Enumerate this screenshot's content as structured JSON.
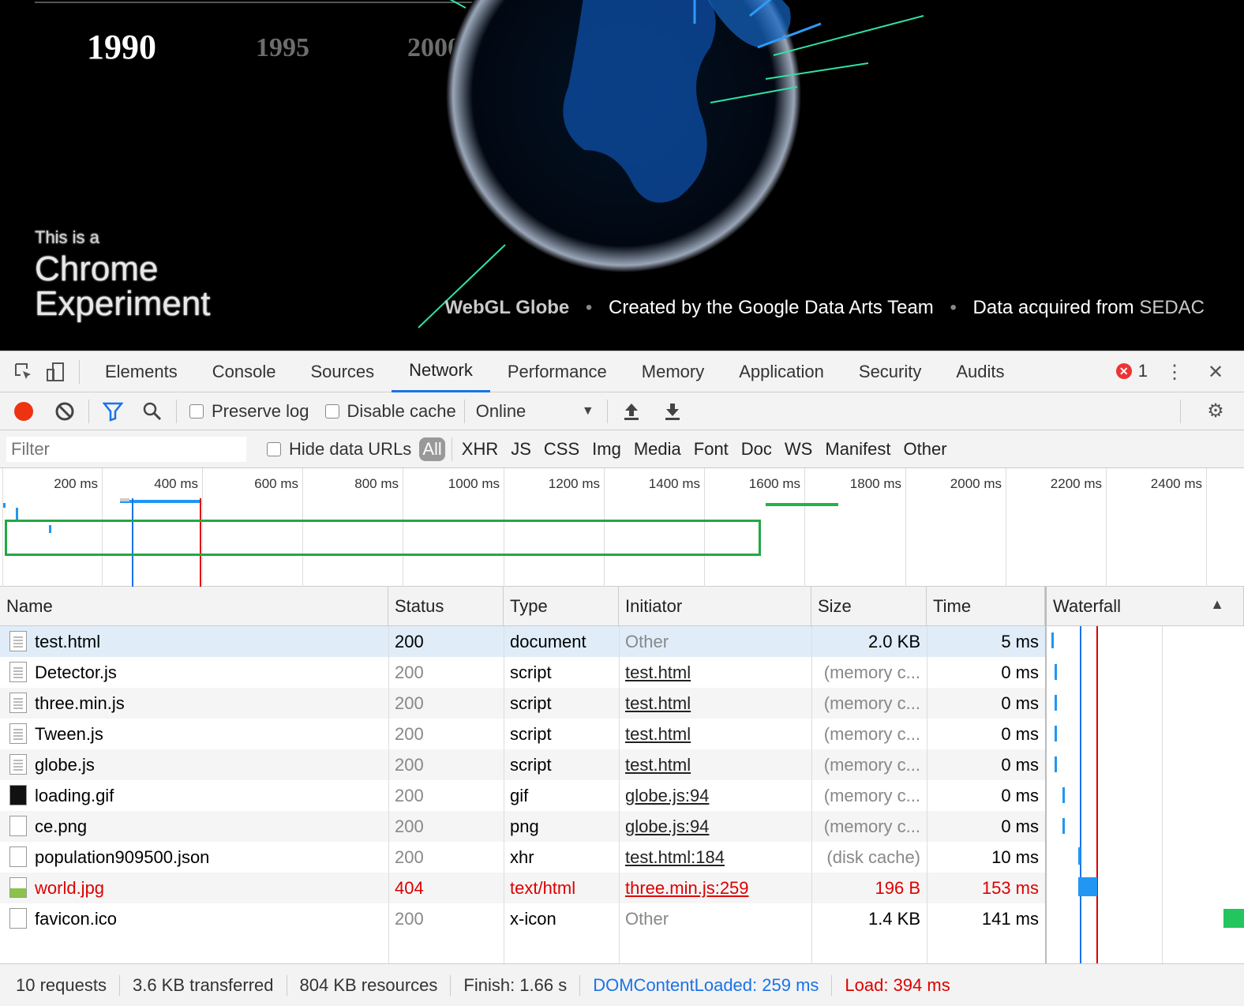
{
  "webpage": {
    "years": [
      "1990",
      "1995",
      "2000"
    ],
    "experiment_small": "This is a",
    "experiment_line1": "Chrome",
    "experiment_line2": "Experiment",
    "credits": {
      "app": "WebGL Globe",
      "team": "Created by the Google Data Arts Team",
      "data_prefix": "Data acquired from",
      "data_source": "SEDAC"
    }
  },
  "devtools": {
    "tabs": [
      "Elements",
      "Console",
      "Sources",
      "Network",
      "Performance",
      "Memory",
      "Application",
      "Security",
      "Audits"
    ],
    "active_tab": "Network",
    "error_count": "1",
    "toolbar": {
      "preserve_log": "Preserve log",
      "disable_cache": "Disable cache",
      "throttle": "Online"
    },
    "filter": {
      "placeholder": "Filter",
      "hide_data_urls": "Hide data URLs",
      "types": [
        "All",
        "XHR",
        "JS",
        "CSS",
        "Img",
        "Media",
        "Font",
        "Doc",
        "WS",
        "Manifest",
        "Other"
      ]
    },
    "overview_ticks": [
      "200 ms",
      "400 ms",
      "600 ms",
      "800 ms",
      "1000 ms",
      "1200 ms",
      "1400 ms",
      "1600 ms",
      "1800 ms",
      "2000 ms",
      "2200 ms",
      "2400 ms"
    ],
    "columns": [
      "Name",
      "Status",
      "Type",
      "Initiator",
      "Size",
      "Time",
      "Waterfall"
    ],
    "rows": [
      {
        "name": "test.html",
        "status": "200",
        "type": "document",
        "initiator": "Other",
        "size": "2.0 KB",
        "time": "5 ms",
        "icon": "doc-icon"
      },
      {
        "name": "Detector.js",
        "status": "200",
        "type": "script",
        "initiator": "test.html",
        "size": "(memory c...",
        "time": "0 ms",
        "icon": "doc-icon"
      },
      {
        "name": "three.min.js",
        "status": "200",
        "type": "script",
        "initiator": "test.html",
        "size": "(memory c...",
        "time": "0 ms",
        "icon": "doc-icon"
      },
      {
        "name": "Tween.js",
        "status": "200",
        "type": "script",
        "initiator": "test.html",
        "size": "(memory c...",
        "time": "0 ms",
        "icon": "doc-icon"
      },
      {
        "name": "globe.js",
        "status": "200",
        "type": "script",
        "initiator": "test.html",
        "size": "(memory c...",
        "time": "0 ms",
        "icon": "doc-icon"
      },
      {
        "name": "loading.gif",
        "status": "200",
        "type": "gif",
        "initiator": "globe.js:94",
        "size": "(memory c...",
        "time": "0 ms",
        "icon": "gif-icon"
      },
      {
        "name": "ce.png",
        "status": "200",
        "type": "png",
        "initiator": "globe.js:94",
        "size": "(memory c...",
        "time": "0 ms",
        "icon": "blank-file-icon"
      },
      {
        "name": "population909500.json",
        "status": "200",
        "type": "xhr",
        "initiator": "test.html:184",
        "size": "(disk cache)",
        "time": "10 ms",
        "icon": "blank-file-icon"
      },
      {
        "name": "world.jpg",
        "status": "404",
        "type": "text/html",
        "initiator": "three.min.js:259",
        "size": "196 B",
        "time": "153 ms",
        "icon": "image-icon"
      },
      {
        "name": "favicon.ico",
        "status": "200",
        "type": "x-icon",
        "initiator": "Other",
        "size": "1.4 KB",
        "time": "141 ms",
        "icon": "blank-file-icon"
      }
    ],
    "status_bar": {
      "requests": "10 requests",
      "transferred": "3.6 KB transferred",
      "resources": "804 KB resources",
      "finish": "Finish: 1.66 s",
      "dom_content_loaded": "DOMContentLoaded: 259 ms",
      "load": "Load: 394 ms"
    },
    "colors": {
      "accent": "#1a73e8",
      "error": "#dd0000",
      "highlight": "#22a844"
    }
  }
}
